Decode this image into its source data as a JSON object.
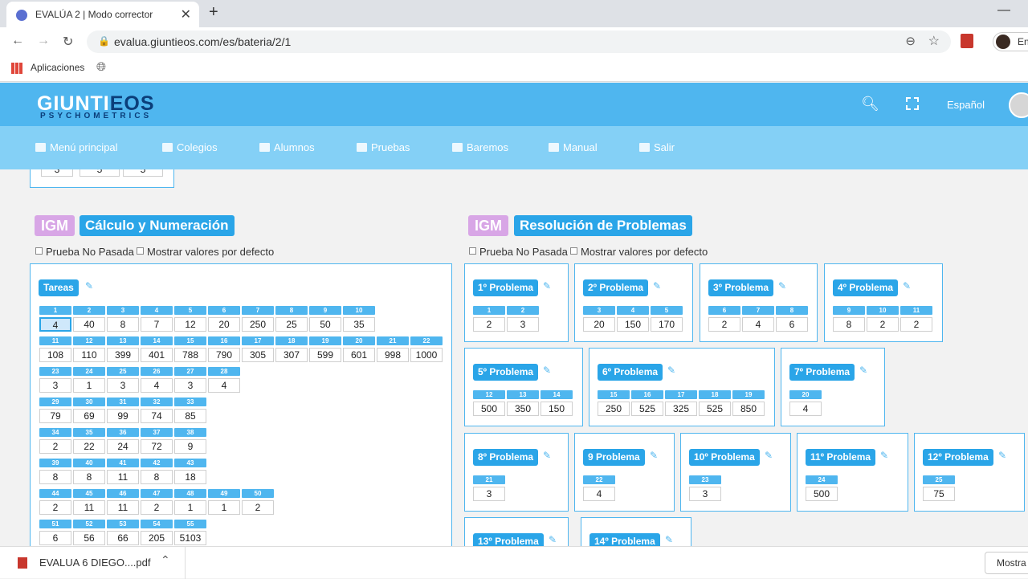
{
  "browser": {
    "tab_title": "EVALÚA 2 | Modo corrector",
    "new_tab": "+",
    "url": "evalua.giuntieos.com/es/bateria/2/1",
    "profile_label": "En",
    "bookmark_apps": "Aplicaciones"
  },
  "header": {
    "logo_main_a": "GIUNTI",
    "logo_main_b": "EOS",
    "logo_sub": "PSYCHOMETRICS",
    "language": "Español"
  },
  "menu": [
    {
      "label": "Menú principal"
    },
    {
      "label": "Colegios"
    },
    {
      "label": "Alumnos"
    },
    {
      "label": "Pruebas"
    },
    {
      "label": "Baremos"
    },
    {
      "label": "Manual"
    },
    {
      "label": "Salir"
    }
  ],
  "prev_box": {
    "values": [
      "3",
      "5",
      "5"
    ]
  },
  "left_section": {
    "igm": "IGM",
    "title": "Cálculo y Numeración",
    "check_no_pasada": "Prueba No Pasada",
    "check_defaults": "Mostrar valores por defecto",
    "tasks_label": "Tareas",
    "rows": [
      {
        "nums": [
          "1",
          "2",
          "3",
          "4",
          "5",
          "6",
          "7",
          "8",
          "9",
          "10"
        ],
        "vals": [
          "4",
          "40",
          "8",
          "7",
          "12",
          "20",
          "250",
          "25",
          "50",
          "35"
        ]
      },
      {
        "nums": [
          "11",
          "12",
          "13",
          "14",
          "15",
          "16",
          "17",
          "18",
          "19",
          "20",
          "21",
          "22"
        ],
        "vals": [
          "108",
          "110",
          "399",
          "401",
          "788",
          "790",
          "305",
          "307",
          "599",
          "601",
          "998",
          "1000"
        ]
      },
      {
        "nums": [
          "23",
          "24",
          "25",
          "26",
          "27",
          "28"
        ],
        "vals": [
          "3",
          "1",
          "3",
          "4",
          "3",
          "4"
        ]
      },
      {
        "nums": [
          "29",
          "30",
          "31",
          "32",
          "33"
        ],
        "vals": [
          "79",
          "69",
          "99",
          "74",
          "85"
        ]
      },
      {
        "nums": [
          "34",
          "35",
          "36",
          "37",
          "38"
        ],
        "vals": [
          "2",
          "22",
          "24",
          "72",
          "9"
        ]
      },
      {
        "nums": [
          "39",
          "40",
          "41",
          "42",
          "43"
        ],
        "vals": [
          "8",
          "8",
          "11",
          "8",
          "18"
        ]
      },
      {
        "nums": [
          "44",
          "45",
          "46",
          "47",
          "48",
          "49",
          "50"
        ],
        "vals": [
          "2",
          "11",
          "11",
          "2",
          "1",
          "1",
          "2"
        ]
      },
      {
        "nums": [
          "51",
          "52",
          "53",
          "54",
          "55"
        ],
        "vals": [
          "6",
          "56",
          "66",
          "205",
          "5103"
        ]
      }
    ]
  },
  "right_section": {
    "igm": "IGM",
    "title": "Resolución de Problemas",
    "check_no_pasada": "Prueba No Pasada",
    "check_defaults": "Mostrar valores por defecto",
    "problems": [
      {
        "label": "1º Problema",
        "nums": [
          "1",
          "2"
        ],
        "vals": [
          "2",
          "3"
        ]
      },
      {
        "label": "2º Problema",
        "nums": [
          "3",
          "4",
          "5"
        ],
        "vals": [
          "20",
          "150",
          "170"
        ]
      },
      {
        "label": "3º Problema",
        "nums": [
          "6",
          "7",
          "8"
        ],
        "vals": [
          "2",
          "4",
          "6"
        ]
      },
      {
        "label": "4º Problema",
        "nums": [
          "9",
          "10",
          "11"
        ],
        "vals": [
          "8",
          "2",
          "2"
        ]
      },
      {
        "label": "5º Problema",
        "nums": [
          "12",
          "13",
          "14"
        ],
        "vals": [
          "500",
          "350",
          "150"
        ]
      },
      {
        "label": "6º Problema",
        "nums": [
          "15",
          "16",
          "17",
          "18",
          "19"
        ],
        "vals": [
          "250",
          "525",
          "325",
          "525",
          "850"
        ]
      },
      {
        "label": "7º Problema",
        "nums": [
          "20"
        ],
        "vals": [
          "4"
        ]
      },
      {
        "label": "8º Problema",
        "nums": [
          "21"
        ],
        "vals": [
          "3"
        ]
      },
      {
        "label": "9 Problema",
        "nums": [
          "22"
        ],
        "vals": [
          "4"
        ]
      },
      {
        "label": "10º Problema",
        "nums": [
          "23"
        ],
        "vals": [
          "3"
        ]
      },
      {
        "label": "11º Problema",
        "nums": [
          "24"
        ],
        "vals": [
          "500"
        ]
      },
      {
        "label": "12º Problema",
        "nums": [
          "25"
        ],
        "vals": [
          "75"
        ]
      },
      {
        "label": "13º Problema",
        "nums": [],
        "vals": []
      },
      {
        "label": "14º Problema",
        "nums": [],
        "vals": []
      }
    ]
  },
  "downloads": {
    "file": "EVALUA 6 DIEGO....pdf",
    "show_all": "Mostra"
  },
  "colors": {
    "header": "#4fb6ef",
    "menu": "#84d0f6",
    "accent": "#2aa5e8",
    "igm_tag": "#d8a6e6"
  }
}
